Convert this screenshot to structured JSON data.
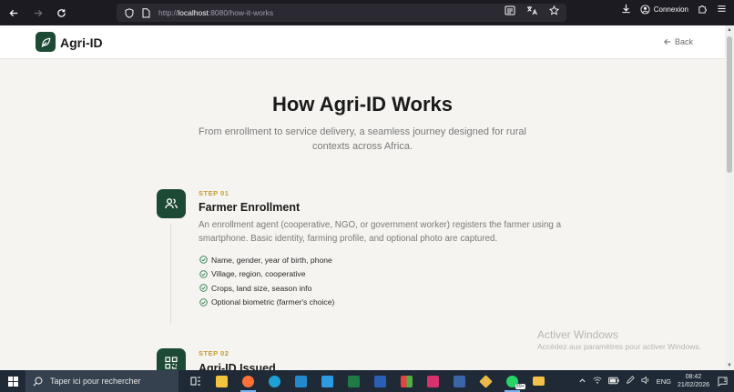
{
  "browser": {
    "url_prefix": "http://",
    "url_host": "localhost",
    "url_rest": ":8080/how-it-works",
    "account_label": "Connexion"
  },
  "header": {
    "brand": "Agri-ID",
    "back_label": "Back"
  },
  "hero": {
    "title": "How Agri-ID Works",
    "subtitle": "From enrollment to service delivery, a seamless journey designed for rural contexts across Africa."
  },
  "steps": [
    {
      "label": "STEP 01",
      "title": "Farmer Enrollment",
      "description": "An enrollment agent (cooperative, NGO, or government worker) registers the farmer using a smartphone. Basic identity, farming profile, and optional photo are captured.",
      "items": [
        "Name, gender, year of birth, phone",
        "Village, region, cooperative",
        "Crops, land size, season info",
        "Optional biometric (farmer's choice)"
      ]
    },
    {
      "label": "STEP 02",
      "title": "Agri-ID Issued"
    }
  ],
  "watermark": {
    "title": "Activer Windows",
    "subtitle": "Accédez aux paramètres pour activer Windows."
  },
  "taskbar": {
    "search_placeholder": "Taper ici pour rechercher",
    "language": "ENG",
    "time": "08:42",
    "date": "21/02/2026",
    "badge": "99+",
    "notification_count": "1"
  },
  "colors": {
    "brand_green": "#1d4a35",
    "step_gold": "#c9982f",
    "check_green": "#2e7d4f"
  }
}
